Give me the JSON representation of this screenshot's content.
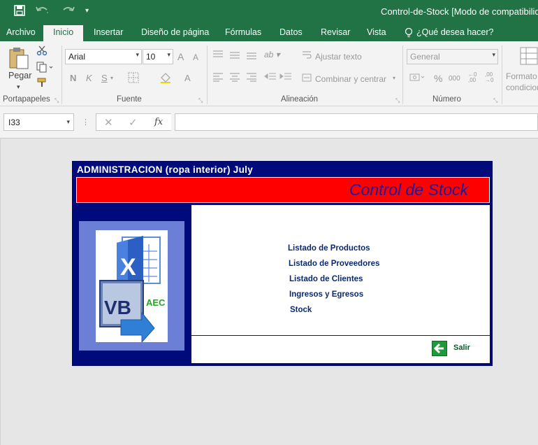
{
  "window": {
    "title": "Control-de-Stock  [Modo de compatibilidad]"
  },
  "ribbon_tabs": [
    "Archivo",
    "Inicio",
    "Insertar",
    "Diseño de página",
    "Fórmulas",
    "Datos",
    "Revisar",
    "Vista"
  ],
  "tell_me": "¿Qué desea hacer?",
  "ribbon": {
    "paste_label": "Pegar",
    "font_name": "Arial",
    "font_size": "10",
    "bold": "N",
    "italic": "K",
    "underline": "S",
    "font_color_glyph": "A",
    "grow_font": "A",
    "shrink_font": "A",
    "wrap_text": "Ajustar texto",
    "merge_center": "Combinar y centrar",
    "number_format": "General",
    "percent": "%",
    "thousands": "000",
    "conditional_format": "Formato\ncondicional",
    "groups": {
      "clipboard": "Portapapeles",
      "font": "Fuente",
      "alignment": "Alineación",
      "number": "Número"
    }
  },
  "formula_bar": {
    "name_box": "I33",
    "fx": "fx",
    "formula": ""
  },
  "form": {
    "title": "ADMINISTRACION (ropa interior) July",
    "brand": "Control de Stock",
    "logo_badge": "AEC",
    "logo_vb": "VB",
    "logo_x": "X",
    "menu": [
      "Listado de Productos",
      "Listado de Proveedores",
      "Listado de Clientes",
      "Ingresos y Egresos",
      "Stock"
    ],
    "exit_label": "Salir"
  },
  "colors": {
    "excel_green": "#217346",
    "form_navy": "#000a7a",
    "banner_red": "#ff0000",
    "brand_blue": "#1a1aa0",
    "link_navy": "#0b2a6e",
    "logo_frame": "#6b7fd6"
  },
  "icons": [
    "save-icon",
    "undo-icon",
    "redo-icon",
    "customize-qat-icon",
    "paste-icon",
    "cut-icon",
    "copy-icon",
    "format-painter-icon",
    "lightbulb-icon",
    "exit-arrow-icon"
  ]
}
